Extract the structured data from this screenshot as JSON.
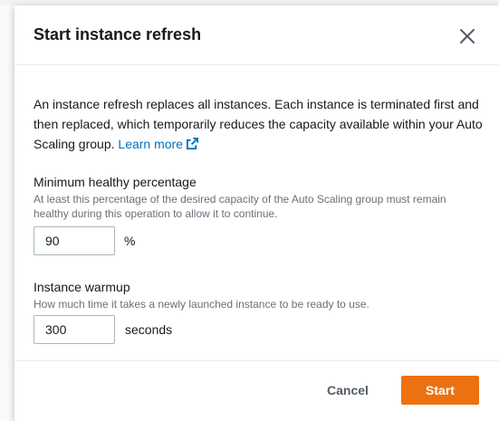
{
  "modal": {
    "title": "Start instance refresh",
    "description": "An instance refresh replaces all instances. Each instance is terminated first and then replaced, which temporarily reduces the capacity available within your Auto Scaling group. ",
    "learn_more_label": "Learn more"
  },
  "min_healthy": {
    "label": "Minimum healthy percentage",
    "hint": "At least this percentage of the desired capacity of the Auto Scaling group must remain healthy during this operation to allow it to continue.",
    "value": "90",
    "unit": "%"
  },
  "warmup": {
    "label": "Instance warmup",
    "hint": "How much time it takes a newly launched instance to be ready to use.",
    "value": "300",
    "unit": "seconds"
  },
  "footer": {
    "cancel_label": "Cancel",
    "start_label": "Start"
  },
  "colors": {
    "primary_button": "#ec7211",
    "link": "#0073bb"
  },
  "icons": {
    "close": "close-icon",
    "external_link": "external-link-icon"
  }
}
